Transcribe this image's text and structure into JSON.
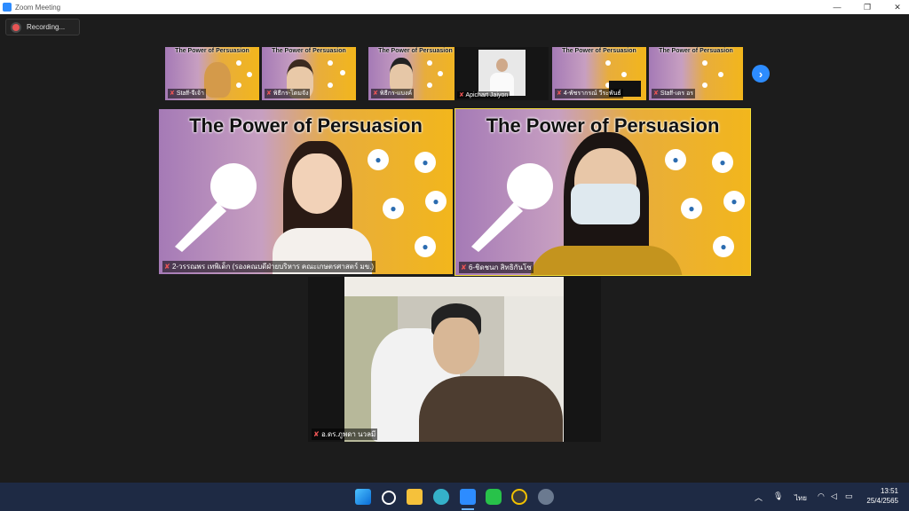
{
  "window": {
    "title": "Zoom Meeting"
  },
  "recording": {
    "label": "Recording..."
  },
  "slide_title": "The Power of Persuasion",
  "thumbnails": [
    {
      "name": "Staff-จีเจ้า",
      "kind": "slide"
    },
    {
      "name": "พิธีกร-โดมจัง",
      "kind": "slide"
    },
    {
      "name": "พิธีกร-แบงค์",
      "kind": "slide"
    },
    {
      "name": "Apichart Jaiyon",
      "kind": "camera"
    },
    {
      "name": "4-พัชรากรณ์ วีระพันธ์",
      "kind": "slide"
    },
    {
      "name": "Staff-เดร อร",
      "kind": "slide"
    }
  ],
  "main_tiles": [
    {
      "name": "2-วรรณพร เทพิเด็ก (รองคณบดีฝ่ายบริหาร คณะเกษตรศาสตร์ มข.)"
    },
    {
      "name": "6-ชิดชนก สิทธิกันโซ"
    },
    {
      "name": "อ.ดร.ภูพดา นวลมี"
    }
  ],
  "taskbar": {
    "apps": [
      "start-icon",
      "search-icon",
      "file-explorer-icon",
      "edge-icon",
      "zoom-icon",
      "line-icon",
      "app-icon",
      "settings-icon"
    ],
    "tray_lang": "ไทย",
    "time": "13:51",
    "date": "25/4/2565"
  },
  "colors": {
    "zoom_blue": "#2D8CFF",
    "active_speaker": "#f3df3a",
    "taskbar": "#1e2a44"
  }
}
